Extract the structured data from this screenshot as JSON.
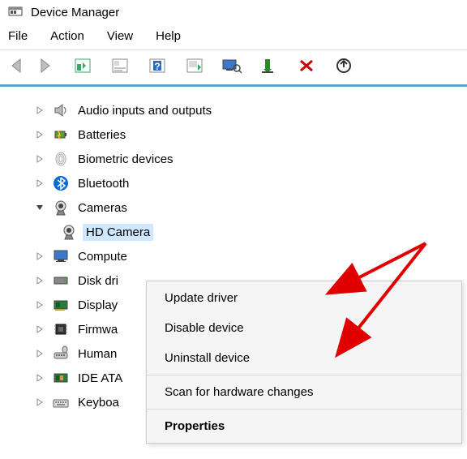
{
  "window": {
    "title": "Device Manager"
  },
  "menu": {
    "file": "File",
    "action": "Action",
    "view": "View",
    "help": "Help"
  },
  "tree": {
    "items": [
      {
        "label": "Audio inputs and outputs",
        "expanded": false
      },
      {
        "label": "Batteries",
        "expanded": false
      },
      {
        "label": "Biometric devices",
        "expanded": false
      },
      {
        "label": "Bluetooth",
        "expanded": false
      },
      {
        "label": "Cameras",
        "expanded": true,
        "children": [
          {
            "label": "HD Camera",
            "selected": true
          }
        ]
      },
      {
        "label": "Compute",
        "expanded": false
      },
      {
        "label": "Disk dri",
        "expanded": false
      },
      {
        "label": "Display",
        "expanded": false
      },
      {
        "label": "Firmwa",
        "expanded": false
      },
      {
        "label": "Human",
        "expanded": false
      },
      {
        "label": "IDE ATA",
        "expanded": false
      },
      {
        "label": "Keyboa",
        "expanded": false
      }
    ]
  },
  "contextmenu": {
    "update": "Update driver",
    "disable": "Disable device",
    "uninstall": "Uninstall device",
    "scan": "Scan for hardware changes",
    "properties": "Properties"
  }
}
